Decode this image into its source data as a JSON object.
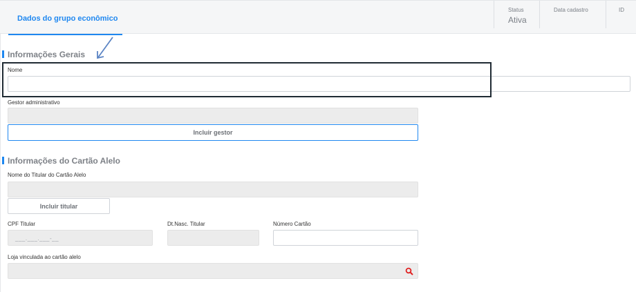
{
  "header": {
    "tab_label": "Dados do grupo econômico",
    "status_label": "Status",
    "status_value": "Ativa",
    "data_cadastro_label": "Data cadastro",
    "id_label": "ID"
  },
  "general_section": {
    "title": "Informações Gerais",
    "nome_label": "Nome",
    "nome_value": "",
    "gestor_label": "Gestor administrativo",
    "gestor_value": "",
    "incluir_gestor": "Incluir gestor"
  },
  "card_section": {
    "title": "Informações do Cartão Alelo",
    "titular_label": "Nome do Titular do Cartão Alelo",
    "titular_value": "",
    "incluir_titular": "Incluir titular",
    "cpf_label": "CPF Titular",
    "cpf_placeholder": "___.___.___-__",
    "dtnasc_label": "Dt.Nasc. Titular",
    "numero_label": "Número Cartão",
    "numero_value": "",
    "loja_label": "Loja vinculada ao cartão alelo",
    "loja_value": ""
  },
  "colors": {
    "accent": "#1e87f0",
    "highlight": "#1f2a33",
    "search_icon": "#e02020"
  },
  "icons": {
    "search": "search-icon",
    "annotation": "arrow-icon"
  }
}
